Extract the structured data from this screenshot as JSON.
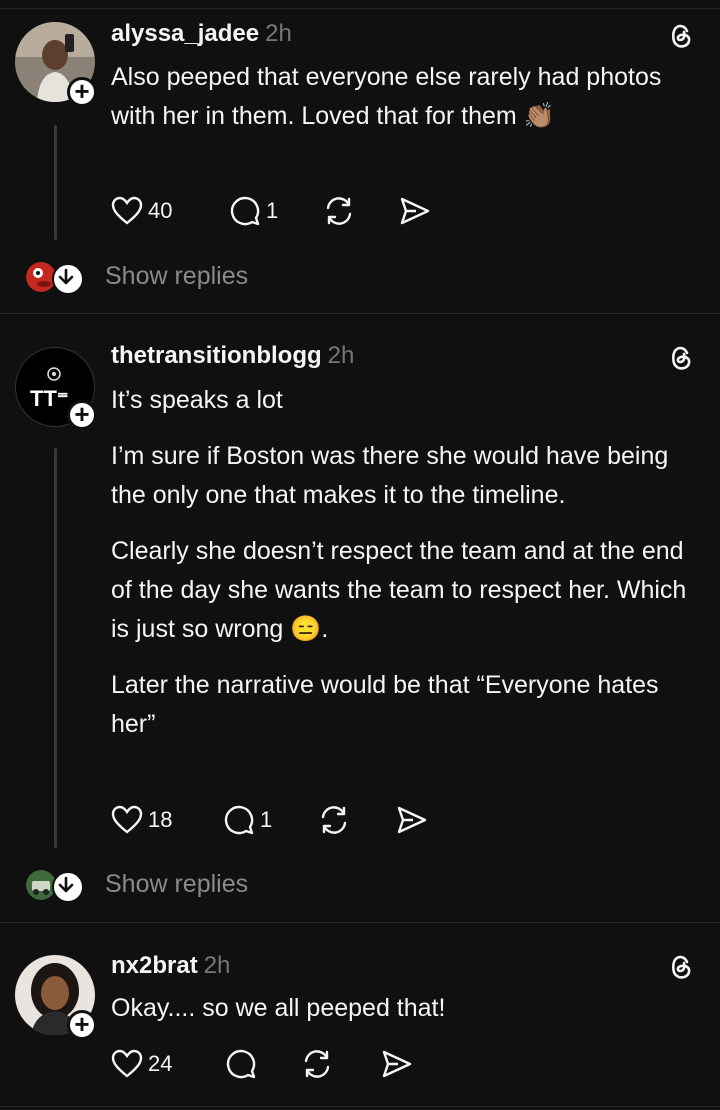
{
  "posts": [
    {
      "username": "alyssa_jadee",
      "time": "2h",
      "paragraphs": [
        "Also peeped that everyone else rarely had photos with her in them. Loved that for them 👏🏽"
      ],
      "likes": "40",
      "replies": "1",
      "show_replies": "Show replies"
    },
    {
      "username": "thetransitionblogg",
      "time": "2h",
      "avatar_text": "TT⁼",
      "paragraphs": [
        "It’s speaks a lot",
        "I’m sure if Boston was there she would have being the only one that makes it to the timeline.",
        "Clearly she doesn’t respect the team and at the end of the day she wants the team to respect her. Which is just so wrong 😑.",
        "Later the narrative would be that “Everyone hates her”"
      ],
      "likes": "18",
      "replies": "1",
      "show_replies": "Show replies"
    },
    {
      "username": "nx2brat",
      "time": "2h",
      "paragraphs": [
        "Okay.... so we all peeped that!"
      ],
      "likes": "24",
      "replies": ""
    }
  ],
  "icons": {
    "like": "heart-icon",
    "reply": "comment-icon",
    "repost": "repost-icon",
    "share": "send-icon",
    "logo": "threads-logo-icon"
  },
  "colors": {
    "background": "#101010",
    "text": "#f3f5f7",
    "muted": "#777777"
  }
}
